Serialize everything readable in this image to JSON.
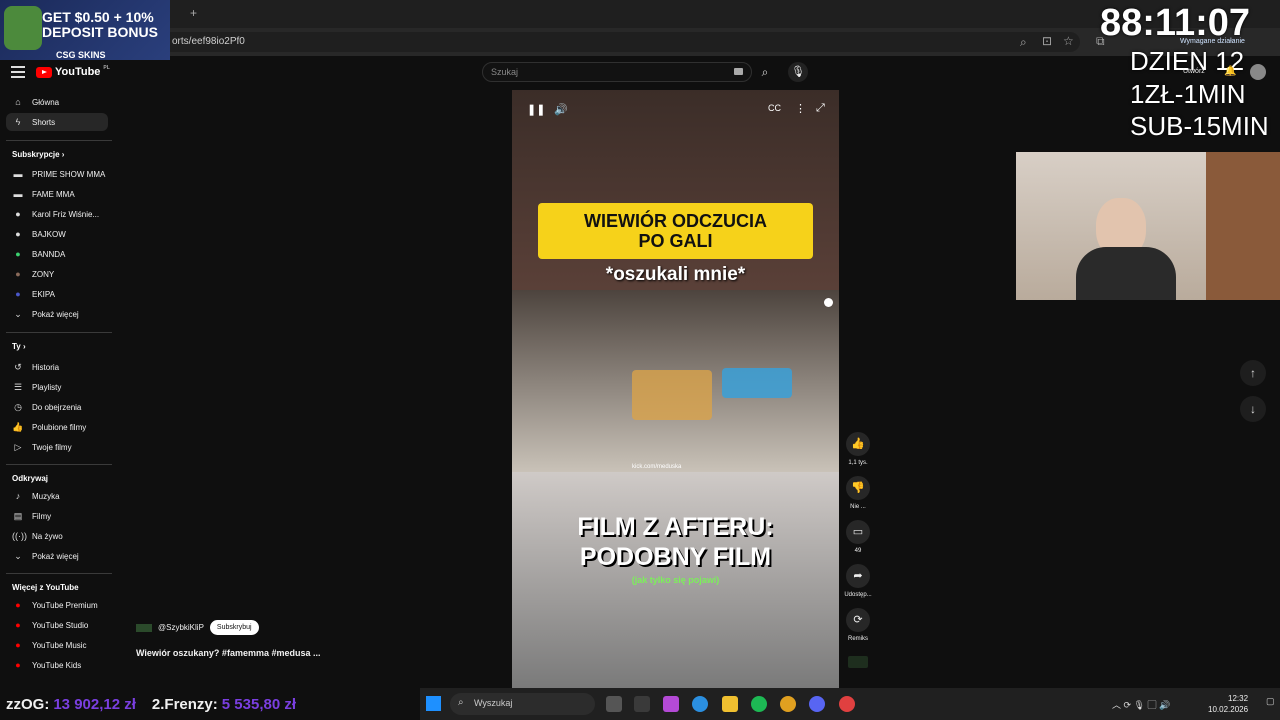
{
  "promo": {
    "line1": "GET $0.50 + 10%",
    "line2": "DEPOSIT BONUS",
    "brand": "CSG SKINS"
  },
  "browser": {
    "url": "orts/eef98io2Pf0",
    "new_tab": "+",
    "action_label": "Wymagane działanie"
  },
  "overlay": {
    "timer": "88:11:07",
    "day": "DZIEN 12",
    "rate1": "1ZŁ-1MIN",
    "rate2": "SUB-15MIN"
  },
  "header": {
    "logo": "YouTube",
    "logo_sup": "PL",
    "search_placeholder": "Szukaj",
    "create": "Utwórz"
  },
  "sidebar": {
    "main": [
      {
        "label": "Główna",
        "icon": "home-icon"
      },
      {
        "label": "Shorts",
        "icon": "shorts-icon"
      }
    ],
    "subs_title": "Subskrypcje",
    "subs": [
      {
        "label": "PRIME SHOW MMA",
        "color": "#c8102e"
      },
      {
        "label": "FAME MMA",
        "color": "#ffffff"
      },
      {
        "label": "Karol Friz Wiśnie...",
        "color": "#b0b0b0"
      },
      {
        "label": "BAJKOW",
        "color": "#e8e8e8"
      },
      {
        "label": "BANNDA",
        "color": "#3bd16f"
      },
      {
        "label": "ZONY",
        "color": "#8a6a5a"
      },
      {
        "label": "EKIPA",
        "color": "#4a57c9"
      },
      {
        "label": "Pokaż więcej",
        "color": ""
      }
    ],
    "you_title": "Ty",
    "you": [
      {
        "label": "Historia",
        "icon": "history-icon"
      },
      {
        "label": "Playlisty",
        "icon": "playlist-icon"
      },
      {
        "label": "Do obejrzenia",
        "icon": "watch-later-icon"
      },
      {
        "label": "Polubione filmy",
        "icon": "liked-icon"
      },
      {
        "label": "Twoje filmy",
        "icon": "your-videos-icon"
      }
    ],
    "explore_title": "Odkrywaj",
    "explore": [
      {
        "label": "Muzyka",
        "icon": "music-icon"
      },
      {
        "label": "Filmy",
        "icon": "film-icon"
      },
      {
        "label": "Na żywo",
        "icon": "live-icon"
      },
      {
        "label": "Pokaż więcej",
        "icon": "chevron-down-icon"
      }
    ],
    "more_title": "Więcej z YouTube",
    "more": [
      {
        "label": "YouTube Premium"
      },
      {
        "label": "YouTube Studio"
      },
      {
        "label": "YouTube Music"
      },
      {
        "label": "YouTube Kids"
      }
    ]
  },
  "video": {
    "yellow_line1": "WIEWIÓR ODCZUCIA",
    "yellow_line2": "PO GALI",
    "caption1": "*oszukali mnie*",
    "kick": "kick.com/meduska",
    "caption2_line1": "FILM Z AFTERU:",
    "caption2_line2": "PODOBNY FILM",
    "caption3": "(jak tylko się pojawi)"
  },
  "actions": {
    "likes": "1,1 tys.",
    "dislike": "Nie ...",
    "comments": "49",
    "share": "Udostęp...",
    "remix": "Remiks"
  },
  "channel": {
    "handle": "@SzybkiKliP",
    "subscribe": "Subskrybuj",
    "title": "Wiewiór oszukany? #famemma #medusa ..."
  },
  "stats": {
    "label1": "zzOG:",
    "value1": "13 902,12 zł",
    "label2": "2.Frenzy:",
    "value2": "5 535,80 zł"
  },
  "taskbar": {
    "search": "Wyszukaj",
    "time": "12:32",
    "date": "10.02.2026"
  }
}
